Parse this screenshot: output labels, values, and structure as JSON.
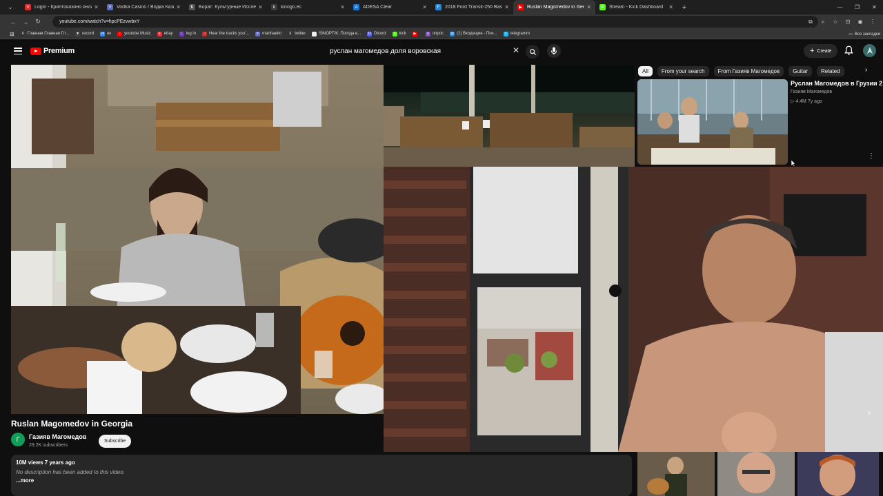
{
  "browser": {
    "tabs": [
      {
        "title": "Login - Криптоказино онлай",
        "color": "#d32f2f",
        "glyph": "V"
      },
      {
        "title": "Vodka Casino / Водка Казино",
        "color": "#5c6bc0",
        "glyph": "V"
      },
      {
        "title": "Борат: Культурные Исследов",
        "color": "#555555",
        "glyph": "Б"
      },
      {
        "title": "kinogo.ec",
        "color": "#3a3a3a",
        "glyph": "k"
      },
      {
        "title": "ADESA Clear",
        "color": "#1976d2",
        "glyph": "A"
      },
      {
        "title": "2018 Ford Transit-250 Base w/",
        "color": "#1e88e5",
        "glyph": "F"
      },
      {
        "title": "Ruslan Magomedov in Geo",
        "color": "#ff0000",
        "glyph": "▶"
      },
      {
        "title": "Stream - Kick Dashboard",
        "color": "#53fc18",
        "glyph": "K"
      }
    ],
    "active_tab": 6,
    "url": "youtube.com/watch?v=hpcPEzvwbxY",
    "bookmarks": [
      {
        "label": "Главная Главная Гл...",
        "color": "#333333",
        "glyph": "X"
      },
      {
        "label": "record",
        "color": "#444444",
        "glyph": "▼"
      },
      {
        "label": "вк",
        "color": "#2787f5",
        "glyph": "vk"
      },
      {
        "label": "youtube Music",
        "color": "#ff0000",
        "glyph": "♪"
      },
      {
        "label": "ebay",
        "color": "#e53238",
        "glyph": "e"
      },
      {
        "label": "log in",
        "color": "#6a3ab2",
        "glyph": "L"
      },
      {
        "label": "Hear the tracks you'...",
        "color": "#c62828",
        "glyph": "♫"
      },
      {
        "label": "manhaeim",
        "color": "#5c6bc0",
        "glyph": "m"
      },
      {
        "label": "twitter",
        "color": "#333333",
        "glyph": "X"
      },
      {
        "label": "SINOPTIK: Погода в...",
        "color": "#eeeeee",
        "glyph": "S"
      },
      {
        "label": "Dicord",
        "color": "#5865f2",
        "glyph": "D"
      },
      {
        "label": "kick",
        "color": "#53fc18",
        "glyph": "k"
      },
      {
        "label": "",
        "color": "#ff0000",
        "glyph": "▶"
      },
      {
        "label": "опрос",
        "color": "#7e57c2",
        "glyph": "о"
      },
      {
        "label": "(2) Входящие - Поч...",
        "color": "#1e88e5",
        "glyph": "@"
      },
      {
        "label": "telegramm",
        "color": "#29b6f6",
        "glyph": "t"
      }
    ],
    "bookmarks_right": "Все закладки"
  },
  "youtube": {
    "logo_text": "Premium",
    "search_query": "руслан магомедов доля воровская",
    "create_label": "Create"
  },
  "video": {
    "title": "Ruslan Magomedov in Georgia",
    "channel": "Газияв Магомедов",
    "channel_initial": "Г",
    "subscribers": "29.2K subscribers",
    "subscribe_label": "Subscribe",
    "views_date": "10M views  7 years ago",
    "description": "No description has been added to this video.",
    "more_label": "...more"
  },
  "chips": [
    "All",
    "From your search",
    "From Газияв Магомедов",
    "Guitar",
    "Related"
  ],
  "related": {
    "title": "Руслан Магомедов в Грузии 2",
    "channel": "Газияв Магомедов",
    "meta": "▷ 4.4M  7y ago"
  },
  "colors": {
    "background": "#0f0f0f",
    "chip_active": "#f1f1f1",
    "brand_red": "#ff0000"
  }
}
